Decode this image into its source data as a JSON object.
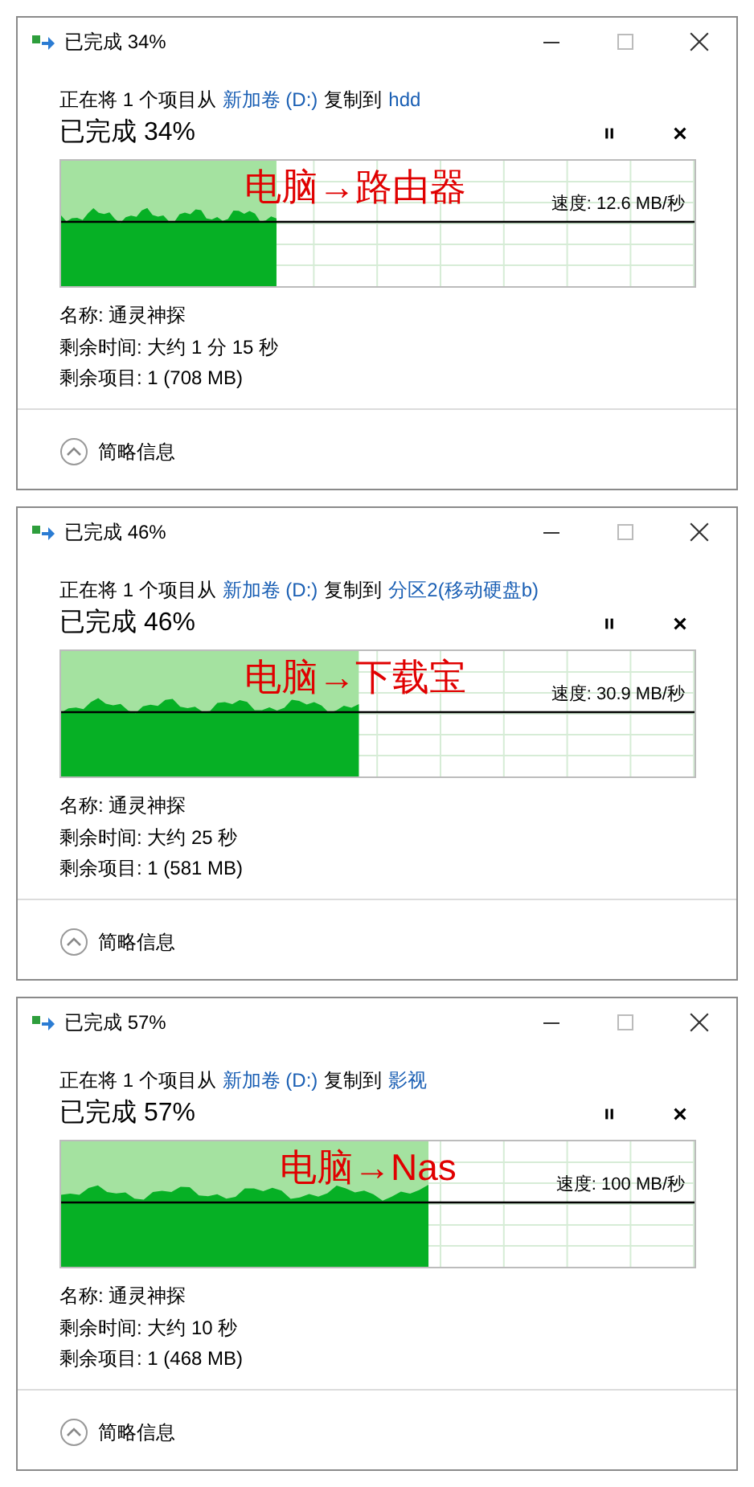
{
  "dialogs": [
    {
      "title": "已完成 34%",
      "copy_prefix": "正在将 1 个项目从",
      "source": "新加卷 (D:)",
      "copy_middle": "复制到",
      "destination": "hdd",
      "progress_title": "已完成 34%",
      "level": 0.34,
      "annotation": "电脑→路由器",
      "speed": "速度: 12.6 MB/秒",
      "name": "名称: 通灵神探",
      "time_left": "剩余时间: 大约 1 分 15 秒",
      "items_left": "剩余项目: 1 (708 MB)",
      "details_toggle": "简略信息"
    },
    {
      "title": "已完成 46%",
      "copy_prefix": "正在将 1 个项目从",
      "source": "新加卷 (D:)",
      "copy_middle": "复制到",
      "destination": "分区2(移动硬盘b)",
      "progress_title": "已完成 46%",
      "level": 0.47,
      "annotation": "电脑→下载宝",
      "speed": "速度: 30.9 MB/秒",
      "name": "名称: 通灵神探",
      "time_left": "剩余时间: 大约 25 秒",
      "items_left": "剩余项目: 1 (581 MB)",
      "details_toggle": "简略信息"
    },
    {
      "title": "已完成 57%",
      "copy_prefix": "正在将 1 个项目从",
      "source": "新加卷 (D:)",
      "copy_middle": "复制到",
      "destination": "影视",
      "progress_title": "已完成 57%",
      "level": 0.58,
      "annotation": "电脑→Nas",
      "speed": "速度: 100 MB/秒",
      "name": "名称: 通灵神探",
      "time_left": "剩余时间: 大约 10 秒",
      "items_left": "剩余项目: 1 (468 MB)",
      "details_toggle": "简略信息"
    }
  ]
}
